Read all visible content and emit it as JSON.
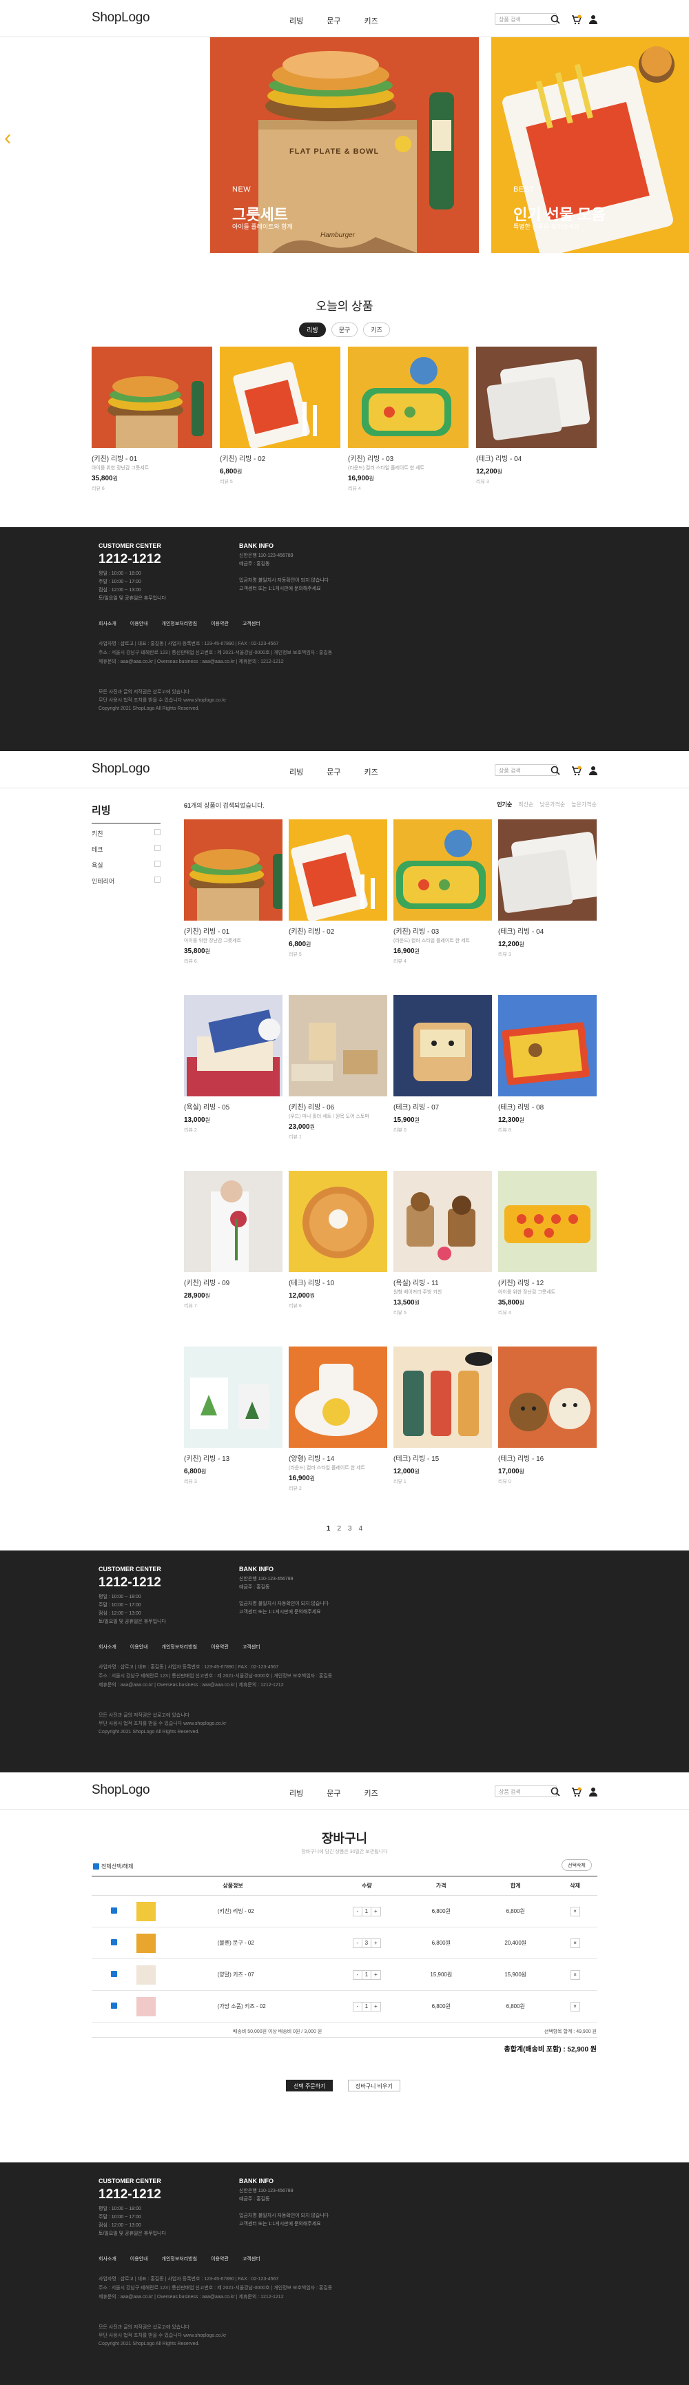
{
  "header": {
    "logo": "ShopLogo",
    "nav": [
      "리빙",
      "문구",
      "키즈"
    ],
    "search_placeholder": "상품 검색"
  },
  "hero": {
    "slides": [
      {
        "tag": "NEW",
        "title": "그릇세트",
        "subtitle": "아이들 플레이트와 함께",
        "box_text": "FLAT PLATE & BOWL",
        "box_brand": "Hamburger"
      },
      {
        "tag": "BEST",
        "title": "인기 선물 모음",
        "subtitle": "특별한 선물을 찾아보세요"
      }
    ],
    "prev_arrow": "‹"
  },
  "today": {
    "title": "오늘의 상품",
    "tabs": [
      "리빙",
      "문구",
      "키즈"
    ],
    "active_tab": 0,
    "products": [
      {
        "name": "(키친) 리빙 - 01",
        "desc": "아이를 위한 장난감 그릇세트",
        "price": "35,800",
        "won": "원",
        "review": "리뷰 6"
      },
      {
        "name": "(키친) 리빙 - 02",
        "desc": "",
        "price": "6,800",
        "won": "원",
        "review": "리뷰 5"
      },
      {
        "name": "(키친) 리빙 - 03",
        "desc": "(라운드) 컬러 스타일 플레이트 한 세트",
        "price": "16,900",
        "won": "원",
        "review": "리뷰 4"
      },
      {
        "name": "(테크) 리빙 - 04",
        "desc": "",
        "price": "12,200",
        "won": "원",
        "review": "리뷰 3"
      }
    ]
  },
  "footer": {
    "center_label": "CUSTOMER CENTER",
    "tel": "1212-1212",
    "hours": [
      "평일 : 10:00 ~ 18:00",
      "주말 : 10:00 ~ 17:00",
      "점심 : 12:00 ~ 13:00",
      "토/일요일 및 공휴일은 휴무입니다"
    ],
    "bank_label": "BANK INFO",
    "bank_info": [
      "신한은행 110-123-456789",
      "예금주 : 홍길동",
      "",
      "입금자명 불일치시 자동확인이 되지 않습니다",
      "고객센터 또는 1:1게시판에 문의해주세요"
    ],
    "links": [
      "회사소개",
      "이용안내",
      "개인정보처리방침",
      "이용약관",
      "고객센터"
    ],
    "info": [
      "사업자명 : 샵로고 | 대표 : 홍길동 | 사업자 등록번호 : 123-45-67890 | FAX : 02-123-4567",
      "주소 : 서울시 강남구 테헤란로 123 | 통신판매업 신고번호 : 제 2021-서울강남-0000호 | 개인정보 보호책임자 : 홍길동",
      "제휴문의 : aaa@aaa.co.kr | Overseas business : aaa@aaa.co.kr | 제휴문의 : 1212-1212"
    ],
    "copy": [
      "모든 사진과 글의 저작권은 샵로고에 있습니다",
      "무단 사용시 법적 조치를 받을 수 있습니다 www.shoplogo.co.kr",
      "Copyright 2021 ShopLogo All Rights Reserved."
    ]
  },
  "listing": {
    "category_title": "리빙",
    "filters": [
      "키친",
      "테크",
      "욕실",
      "인테리어"
    ],
    "count_num": "61",
    "count_text": "개의 상품이 검색되었습니다.",
    "sort": [
      "인기순",
      "최신순",
      "낮은가격순",
      "높은가격순"
    ],
    "products": [
      {
        "name": "(키친) 리빙 - 01",
        "desc": "아이를 위한 장난감 그릇세트",
        "price": "35,800",
        "won": "원",
        "review": "리뷰 6"
      },
      {
        "name": "(키친) 리빙 - 02",
        "desc": "",
        "price": "6,800",
        "won": "원",
        "review": "리뷰 5"
      },
      {
        "name": "(키친) 리빙 - 03",
        "desc": "(라운드) 컬러 스타일 플레이트 한 세트",
        "price": "16,900",
        "won": "원",
        "review": "리뷰 4"
      },
      {
        "name": "(테크) 리빙 - 04",
        "desc": "",
        "price": "12,200",
        "won": "원",
        "review": "리뷰 3"
      },
      {
        "name": "(욕실) 리빙 - 05",
        "desc": "",
        "price": "13,000",
        "won": "원",
        "review": "리뷰 2"
      },
      {
        "name": "(키친) 리빙 - 06",
        "desc": "(우드) 미니 홀더 세트 / 원목 도어 스토퍼",
        "price": "23,000",
        "won": "원",
        "review": "리뷰 1"
      },
      {
        "name": "(테크) 리빙 - 07",
        "desc": "",
        "price": "15,900",
        "won": "원",
        "review": "리뷰 0"
      },
      {
        "name": "(테크) 리빙 - 08",
        "desc": "",
        "price": "12,300",
        "won": "원",
        "review": "리뷰 8"
      },
      {
        "name": "(키친) 리빙 - 09",
        "desc": "",
        "price": "28,900",
        "won": "원",
        "review": "리뷰 7"
      },
      {
        "name": "(테크) 리빙 - 10",
        "desc": "",
        "price": "12,000",
        "won": "원",
        "review": "리뷰 6"
      },
      {
        "name": "(욕실) 리빙 - 11",
        "desc": "원형 베이커리 주방 키친",
        "price": "13,500",
        "won": "원",
        "review": "리뷰 5"
      },
      {
        "name": "(키친) 리빙 - 12",
        "desc": "아이를 위한 장난감 그릇세트",
        "price": "35,800",
        "won": "원",
        "review": "리뷰 4"
      },
      {
        "name": "(키친) 리빙 - 13",
        "desc": "",
        "price": "6,800",
        "won": "원",
        "review": "리뷰 3"
      },
      {
        "name": "(양형) 리빙 - 14",
        "desc": "(라운드) 컬러 스타일 플레이트 한 세트",
        "price": "16,900",
        "won": "원",
        "review": "리뷰 2"
      },
      {
        "name": "(테크) 리빙 - 15",
        "desc": "",
        "price": "12,000",
        "won": "원",
        "review": "리뷰 1"
      },
      {
        "name": "(테크) 리빙 - 16",
        "desc": "",
        "price": "17,000",
        "won": "원",
        "review": "리뷰 0"
      }
    ],
    "pages": [
      "1",
      "2",
      "3",
      "4"
    ]
  },
  "cart": {
    "title": "장바구니",
    "subtitle": "장바구니에 담긴 상품은 30일간 보관됩니다",
    "select_all": "전체선택/해제",
    "delete_selected": "선택삭제",
    "headers": [
      "상품정보",
      "수량",
      "가격",
      "합계",
      "삭제"
    ],
    "qty_minus": "-",
    "qty_plus": "+",
    "remove": "×",
    "items": [
      {
        "name": "(키친) 리빙 - 02",
        "qty": "1",
        "price": "6,800원",
        "total": "6,800원"
      },
      {
        "name": "(볼펜) 문구 - 02",
        "qty": "3",
        "price": "6,800원",
        "total": "20,400원"
      },
      {
        "name": "(양말) 키즈 - 07",
        "qty": "1",
        "price": "15,900원",
        "total": "15,900원"
      },
      {
        "name": "(가방 소품) 키즈 - 02",
        "qty": "1",
        "price": "6,800원",
        "total": "6,800원"
      }
    ],
    "shipping_note": "배송비 50,000원 이상 배송비 0원 / 3,000 원",
    "selected_total": "선택항목 합계 : 49,900 원",
    "grand_total": "총합계(배송비 포함) : 52,900 원",
    "order_button": "선택 주문하기",
    "continue_button": "장바구니 비우기"
  },
  "colors": {
    "accent": "#222222",
    "footer_bg": "#222222",
    "checkbox": "#1976d2"
  }
}
